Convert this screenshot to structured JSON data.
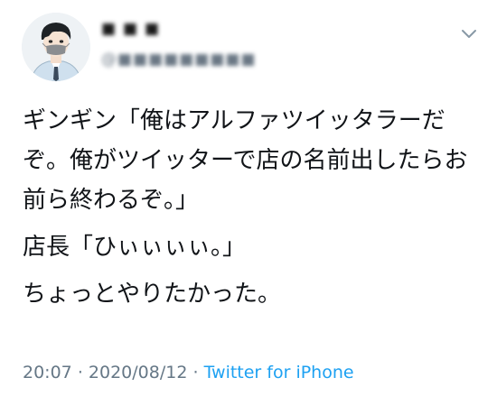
{
  "tweet": {
    "display_name": "■ ■ ■",
    "handle": "@■■■■■■■■■",
    "body": {
      "paragraph1": "ギンギン「俺はアルファツイッタラーだぞ。俺がツイッターで店の名前出したらお前ら終わるぞ。」",
      "paragraph2": "店長「ひぃぃぃぃ。」",
      "paragraph3": "ちょっとやりたかった。"
    },
    "meta": {
      "time": "20:07",
      "separator": "·",
      "date": "2020/08/12",
      "source": "Twitter for iPhone"
    }
  },
  "icons": {
    "avatar": "user-avatar",
    "menu": "chevron-down-icon"
  }
}
